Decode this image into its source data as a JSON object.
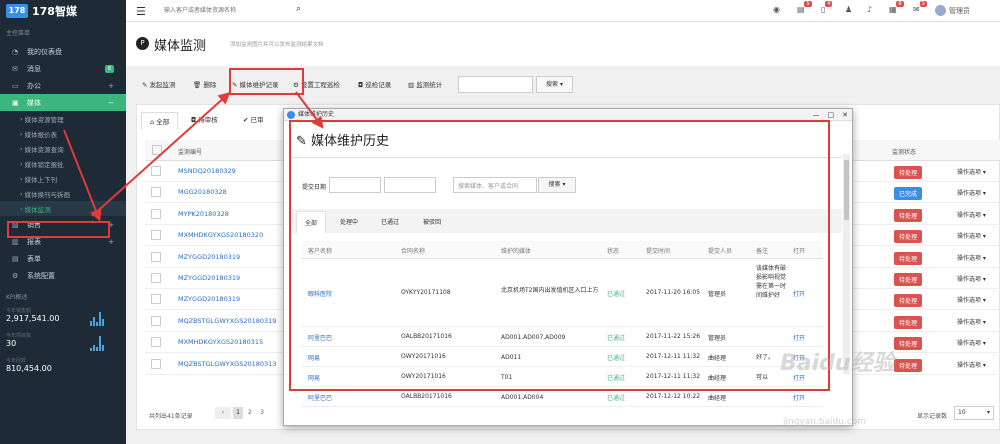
{
  "app": {
    "logo_mark": "178",
    "logo_text": "178智媒"
  },
  "topbar": {
    "search_placeholder": "输入客户或者媒体资源名称",
    "badges": [
      "5",
      "4",
      "8",
      "3"
    ],
    "user": "管理员"
  },
  "sidebar": {
    "section": "主控菜单",
    "items": [
      {
        "label": "我的仪表盘",
        "icon": "dashboard-icon"
      },
      {
        "label": "消息",
        "icon": "mail-icon",
        "badge": "8"
      },
      {
        "label": "办公",
        "icon": "briefcase-icon",
        "plus": "+"
      },
      {
        "label": "媒体",
        "icon": "media-icon",
        "plus": "−"
      }
    ],
    "media_subitems": [
      "媒体资源管理",
      "媒体报价表",
      "媒体资源查询",
      "媒体锁定报批",
      "媒体上下刊",
      "媒体换刊与拆画",
      "媒体监测"
    ],
    "items2": [
      {
        "label": "销售",
        "icon": "sales-icon",
        "plus": "+"
      },
      {
        "label": "报表",
        "icon": "report-icon",
        "plus": "+"
      },
      {
        "label": "表单",
        "icon": "form-icon"
      },
      {
        "label": "系统配置",
        "icon": "gear-icon"
      }
    ],
    "kpi_section": "KPI概述",
    "kpis": [
      {
        "label": "今年销售额",
        "value": "2,917,541.00"
      },
      {
        "label": "今年项目数",
        "value": "30"
      },
      {
        "label": "今年回款",
        "value": "810,454.00"
      }
    ]
  },
  "page": {
    "title": "媒体监测",
    "subtitle": "添加监测图片并可以发布监测结果文档"
  },
  "toolbar": {
    "buttons": [
      "发起监测",
      "删除",
      "媒体维护记录",
      "设置工程巡检",
      "巡检记录",
      "监测统计"
    ],
    "search_btn": "搜索"
  },
  "main": {
    "tabs": [
      "全部",
      "待审核",
      "已审"
    ],
    "col_code": "监测编号",
    "col_status": "监测状态",
    "rows": [
      {
        "code": "MSNDQ20180329",
        "status": "待处理",
        "color": "#d9534f"
      },
      {
        "code": "MGG20180328",
        "status": "已完成",
        "color": "#3a8ee6"
      },
      {
        "code": "MYPK20180328",
        "status": "待处理",
        "color": "#d9534f"
      },
      {
        "code": "MXMHDKGYXGS20180320",
        "status": "待处理",
        "color": "#d9534f"
      },
      {
        "code": "MZYGGD20180319",
        "status": "待处理",
        "color": "#d9534f"
      },
      {
        "code": "MZYGGD20180319",
        "status": "待处理",
        "color": "#d9534f"
      },
      {
        "code": "MZYGGD20180319",
        "status": "待处理",
        "color": "#d9534f"
      },
      {
        "code": "MQZBSTGLGWYXGS20180319",
        "status": "待处理",
        "color": "#d9534f"
      },
      {
        "code": "MXMHDKGYXGS20180315",
        "status": "待处理",
        "color": "#d9534f"
      },
      {
        "code": "MQZBSTGLGWYXGS20180313",
        "status": "待处理",
        "color": "#d9534f"
      }
    ],
    "op_label": "操作选项 ▾",
    "footer_count": "共列出41条记录",
    "pager": [
      "‹",
      "1",
      "2",
      "3"
    ],
    "perpage_label": "显示记录数",
    "perpage": "10"
  },
  "modal": {
    "window_title": "媒体维护历史",
    "title": "媒体维护历史",
    "date_label": "提交日期",
    "search_placeholder": "搜索媒体、客户或合同",
    "search_btn": "搜索",
    "tabs": [
      "全部",
      "处理中",
      "已通过",
      "被驳回"
    ],
    "headers": [
      "客户名称",
      "合同名称",
      "维护的媒体",
      "状态",
      "提交时间",
      "提交人员",
      "备注",
      "打开"
    ],
    "rows": [
      {
        "cust": "眼科医院",
        "contract": "OYKYY20171108",
        "media": "北京机场T2国内出发值机区入口上方",
        "status": "已通过",
        "time": "2017-11-20 16:05",
        "user": "管理员",
        "note": "该媒体有破损影响视觉需在第一时间维护好",
        "open": "打开"
      },
      {
        "cust": "阿里巴巴",
        "contract": "OALBB20171016",
        "media": "AD001,AD007,AD009",
        "status": "已通过",
        "time": "2017-11-22 15:26",
        "user": "管理员",
        "note": "",
        "open": "打开"
      },
      {
        "cust": "网易",
        "contract": "OWY20171016",
        "media": "AD011",
        "status": "已通过",
        "time": "2017-12-11 11:32",
        "user": "曲经理",
        "note": "好了。",
        "open": "打开"
      },
      {
        "cust": "网易",
        "contract": "OWY20171016",
        "media": "T01",
        "status": "已通过",
        "time": "2017-12-11 11:32",
        "user": "曲经理",
        "note": "可以",
        "open": "打开"
      },
      {
        "cust": "阿里巴巴",
        "contract": "OALBB20171016",
        "media": "AD001,AD004",
        "status": "已通过",
        "time": "2017-12-12 10:22",
        "user": "曲经理",
        "note": "",
        "open": "打开"
      }
    ]
  },
  "watermark": {
    "brand": "Baidu经验",
    "url": "jingyan.baidu.com"
  }
}
